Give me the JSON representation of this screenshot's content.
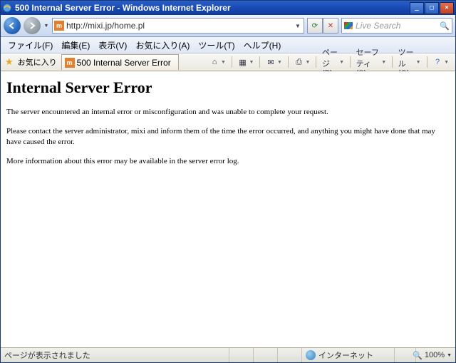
{
  "titlebar": {
    "title": "500 Internal Server Error - Windows Internet Explorer"
  },
  "address": {
    "url": "http://mixi.jp/home.pl",
    "icon_letter": "m"
  },
  "search": {
    "placeholder": "Live Search"
  },
  "menu": {
    "file": "ファイル(F)",
    "edit": "編集(E)",
    "view": "表示(V)",
    "favorites": "お気に入り(A)",
    "tools": "ツール(T)",
    "help": "ヘルプ(H)"
  },
  "favbar": {
    "label": "お気に入り",
    "tab_title": "500 Internal Server Error"
  },
  "cmdbar": {
    "page": "ページ(P)",
    "safety": "セーフティ(S)",
    "tools": "ツール(O)"
  },
  "page": {
    "heading": "Internal Server Error",
    "p1": "The server encountered an internal error or misconfiguration and was unable to complete your request.",
    "p2": "Please contact the server administrator, mixi and inform them of the time the error occurred, and anything you might have done that may have caused the error.",
    "p3": "More information about this error may be available in the server error log."
  },
  "status": {
    "message": "ページが表示されました",
    "zone": "インターネット",
    "zoom": "100%"
  }
}
